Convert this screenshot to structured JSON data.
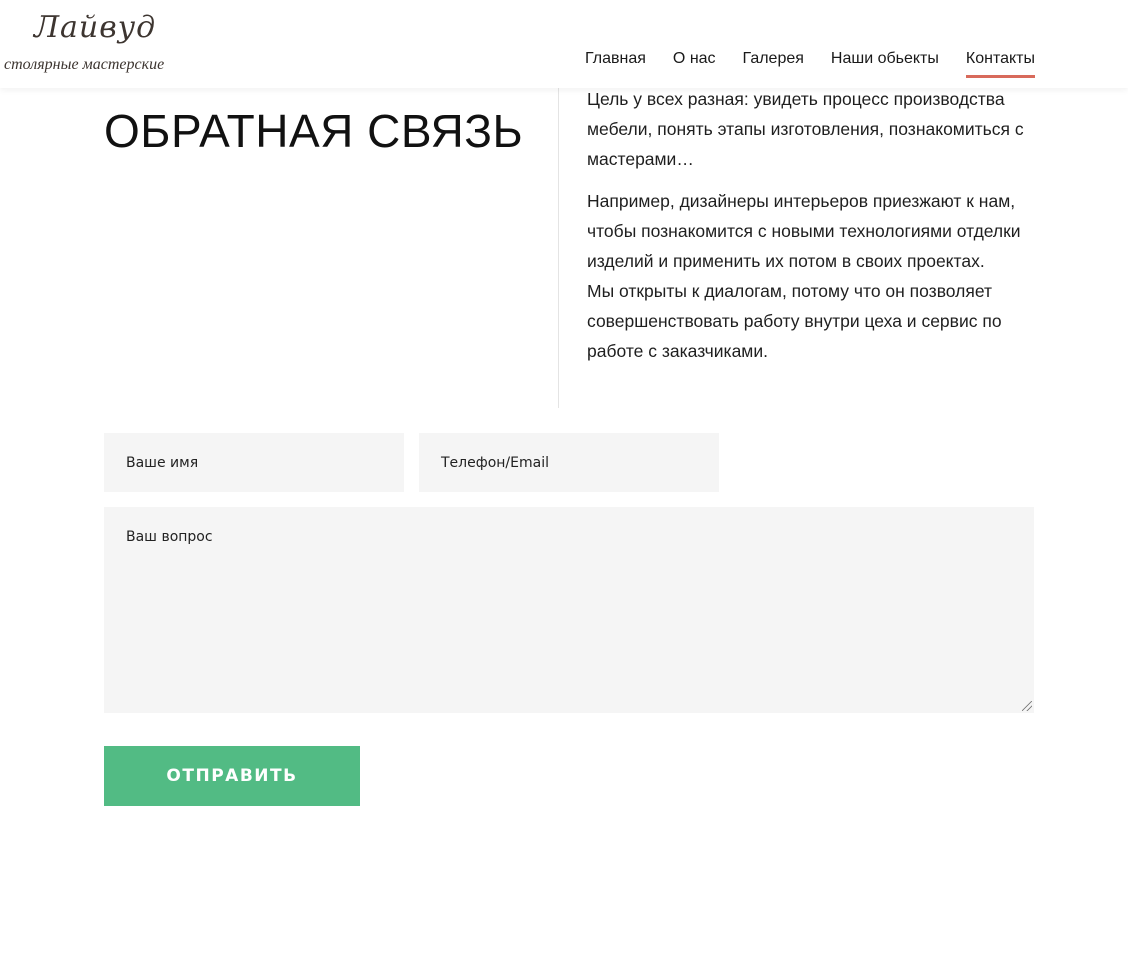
{
  "header": {
    "logo": {
      "script": "Лайвуд",
      "subtitle": "столярные мастерские"
    },
    "nav": [
      {
        "label": "Главная",
        "active": false
      },
      {
        "label": "О нас",
        "active": false
      },
      {
        "label": "Галерея",
        "active": false
      },
      {
        "label": "Наши обьекты",
        "active": false
      },
      {
        "label": "Контакты",
        "active": true
      }
    ],
    "accent_color": "#d86a5b"
  },
  "main": {
    "title": "ОБРАТНАЯ СВЯЗЬ",
    "paragraphs": [
      "Цель у всех разная: увидеть процесс производства мебели, понять этапы изготовления, познакомиться с мастерами…",
      "Например, дизайнеры интерьеров приезжают к нам, чтобы познакомится с новыми технологиями отделки изделий и применить их потом в своих проектах.",
      "Мы открыты к диалогам, потому что он позволяет совершенствовать работу внутри цеха и сервис по работе с заказчиками."
    ]
  },
  "form": {
    "name_placeholder": "Ваше имя",
    "contact_placeholder": "Телефон/Email",
    "question_placeholder": "Ваш вопрос",
    "submit_label": "ОТПРАВИТЬ",
    "submit_color": "#52bb84"
  }
}
